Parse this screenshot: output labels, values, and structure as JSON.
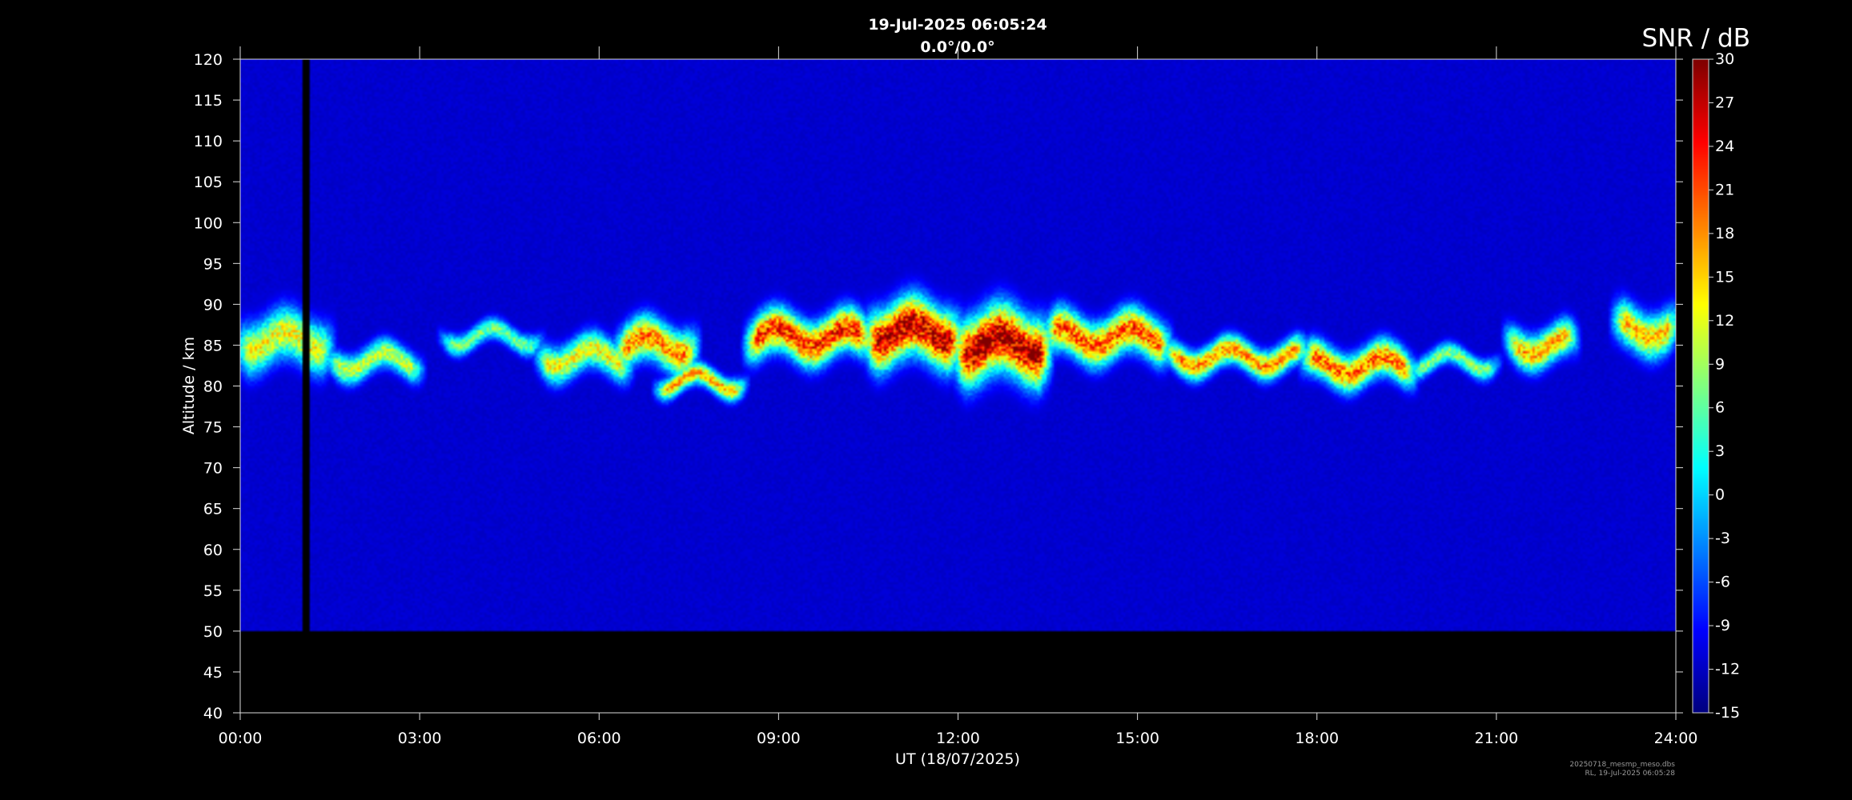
{
  "figure": {
    "title_line1": "19-Jul-2025 06:05:24",
    "title_line2": "0.0°/0.0°",
    "footer_line1": "20250718_mesmp_meso.dbs",
    "footer_line2": "RL, 19-Jul-2025 06:05:28"
  },
  "chart_data": {
    "type": "heatmap",
    "title": "19-Jul-2025 06:05:24",
    "subtitle": "0.0°/0.0°",
    "xlabel": "UT (18/07/2025)",
    "ylabel": "Altitude / km",
    "xlim": [
      0,
      24
    ],
    "ylim": [
      40,
      120
    ],
    "x_ticks": [
      "00:00",
      "03:00",
      "06:00",
      "09:00",
      "12:00",
      "15:00",
      "18:00",
      "21:00",
      "24:00"
    ],
    "y_ticks": [
      40,
      45,
      50,
      55,
      60,
      65,
      70,
      75,
      80,
      85,
      90,
      95,
      100,
      105,
      110,
      115,
      120
    ],
    "colorbar": {
      "label": "SNR / dB",
      "range": [
        -15,
        30
      ],
      "ticks": [
        -15,
        -12,
        -9,
        -6,
        -3,
        0,
        3,
        6,
        9,
        12,
        15,
        18,
        21,
        24,
        27,
        30
      ],
      "colormap": "jet"
    },
    "data_coverage": {
      "altitude_min": 50,
      "altitude_max": 120,
      "gap_time": 1.1
    },
    "echo_layer": {
      "units": "hours UT, km altitude, dB",
      "segments": [
        {
          "t": [
            0.0,
            1.5
          ],
          "center": 85.5,
          "width": 7,
          "peak": 14
        },
        {
          "t": [
            1.5,
            3.0
          ],
          "center": 83.0,
          "width": 4,
          "peak": 12
        },
        {
          "t": [
            3.4,
            5.0
          ],
          "center": 86.0,
          "width": 3,
          "peak": 8
        },
        {
          "t": [
            5.0,
            6.5
          ],
          "center": 83.5,
          "width": 5,
          "peak": 14
        },
        {
          "t": [
            6.3,
            7.6
          ],
          "center": 85.0,
          "width": 6,
          "peak": 20
        },
        {
          "t": [
            7.0,
            8.4
          ],
          "center": 80.5,
          "width": 3,
          "peak": 18
        },
        {
          "t": [
            8.5,
            10.5
          ],
          "center": 86.0,
          "width": 6,
          "peak": 24
        },
        {
          "t": [
            10.5,
            12.0
          ],
          "center": 86.5,
          "width": 8,
          "peak": 29
        },
        {
          "t": [
            12.0,
            13.5
          ],
          "center": 85.0,
          "width": 9,
          "peak": 30
        },
        {
          "t": [
            13.5,
            15.5
          ],
          "center": 86.0,
          "width": 6,
          "peak": 22
        },
        {
          "t": [
            15.5,
            17.8
          ],
          "center": 83.5,
          "width": 4,
          "peak": 19
        },
        {
          "t": [
            17.8,
            19.6
          ],
          "center": 82.5,
          "width": 5,
          "peak": 21
        },
        {
          "t": [
            19.6,
            21.0
          ],
          "center": 83.0,
          "width": 3,
          "peak": 9
        },
        {
          "t": [
            21.2,
            22.3
          ],
          "center": 85.0,
          "width": 5,
          "peak": 18
        },
        {
          "t": [
            23.0,
            24.0
          ],
          "center": 87.0,
          "width": 6,
          "peak": 17
        }
      ]
    }
  }
}
